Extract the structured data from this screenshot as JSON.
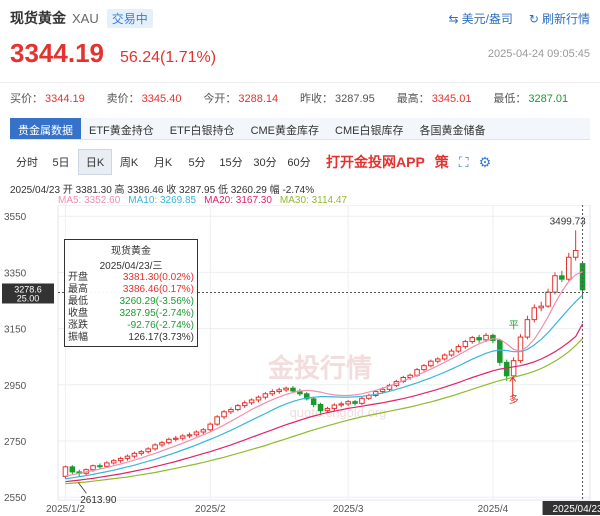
{
  "header": {
    "name": "现货黄金",
    "code": "XAU",
    "status": "交易中",
    "unit_link": "美元/盎司",
    "refresh": "刷新行情"
  },
  "quote": {
    "price": "3344.19",
    "change": "56.24(1.71%)",
    "datetime": "2025-04-24 09:05:45"
  },
  "stats": [
    {
      "label": "买价：",
      "value": "3344.19",
      "cls": "up"
    },
    {
      "label": "卖价：",
      "value": "3345.40",
      "cls": "up"
    },
    {
      "label": "今开：",
      "value": "3288.14",
      "cls": "up"
    },
    {
      "label": "昨收：",
      "value": "3287.95",
      "cls": ""
    },
    {
      "label": "最高：",
      "value": "3345.01",
      "cls": "up"
    },
    {
      "label": "最低：",
      "value": "3287.01",
      "cls": "dn"
    }
  ],
  "data_tabs": [
    "贵金属数据",
    "ETF黄金持仓",
    "ETF白银持仓",
    "CME黄金库存",
    "CME白银库存",
    "各国黄金储备"
  ],
  "period_tabs": [
    "分时",
    "5日",
    "日K",
    "周K",
    "月K",
    "5分",
    "15分",
    "30分",
    "60分"
  ],
  "app_promo": "打开金投网APP",
  "toolbar_icons": [
    "strategy-icon",
    "fullscreen-icon",
    "settings-icon"
  ],
  "toolbar_glyphs": [
    "策",
    "⛶",
    "⚙"
  ],
  "ohlc_line": "2025/04/23  开 3381.30  高 3386.46  收 3287.95  低 3260.29  幅 -2.74%",
  "ma_legend": [
    {
      "label": "MA5: 3352.60",
      "color": "#f08fb0"
    },
    {
      "label": "MA10: 3269.85",
      "color": "#3ab6d9"
    },
    {
      "label": "MA20: 3167.30",
      "color": "#e0246b"
    },
    {
      "label": "MA30: 3114.47",
      "color": "#8fbb2e"
    }
  ],
  "tooltip": {
    "title": "现货黄金",
    "date": "2025/04/23/三",
    "rows": [
      {
        "label": "开盘",
        "value": "3381.30(0.02%)",
        "cls": "up"
      },
      {
        "label": "最高",
        "value": "3386.46(0.17%)",
        "cls": "up"
      },
      {
        "label": "最低",
        "value": "3260.29(-3.56%)",
        "cls": "dn"
      },
      {
        "label": "收盘",
        "value": "3287.95(-2.74%)",
        "cls": "dn"
      },
      {
        "label": "涨跌",
        "value": "-92.76(-2.74%)",
        "cls": "dn"
      },
      {
        "label": "振幅",
        "value": "126.17(3.73%)",
        "cls": ""
      }
    ]
  },
  "crosshair": {
    "price_label": "3278.6",
    "sub_label": "25.00",
    "date_label": "2025/04/23"
  },
  "annotations": {
    "max_label": "3499.73",
    "min_label": "2613.90",
    "ping_label": "平",
    "duo_label": "多"
  },
  "watermark": {
    "main": "金投行情",
    "sub": "quote.cngold.org"
  },
  "colors": {
    "up": "#e4322f",
    "down": "#1a9b2e",
    "accent": "#3672c9"
  },
  "chart_data": {
    "type": "candlestick",
    "y_ticks": [
      2550,
      2750,
      2950,
      3150,
      3350,
      3550
    ],
    "ylim": [
      2540,
      3590
    ],
    "x_ticks": [
      "2025/1/2",
      "2025/2",
      "2025/3",
      "2025/4"
    ],
    "x_tick_index": [
      0,
      21,
      41,
      62
    ],
    "candles": [
      [
        2624,
        2658,
        2616,
        2662
      ],
      [
        2658,
        2640,
        2632,
        2664
      ],
      [
        2640,
        2635,
        2622,
        2648
      ],
      [
        2635,
        2648,
        2628,
        2652
      ],
      [
        2648,
        2662,
        2640,
        2666
      ],
      [
        2662,
        2660,
        2652,
        2670
      ],
      [
        2660,
        2672,
        2654,
        2678
      ],
      [
        2672,
        2680,
        2666,
        2686
      ],
      [
        2680,
        2688,
        2672,
        2694
      ],
      [
        2688,
        2696,
        2680,
        2702
      ],
      [
        2696,
        2706,
        2688,
        2712
      ],
      [
        2706,
        2712,
        2698,
        2718
      ],
      [
        2712,
        2722,
        2706,
        2728
      ],
      [
        2722,
        2736,
        2716,
        2742
      ],
      [
        2736,
        2744,
        2728,
        2750
      ],
      [
        2744,
        2756,
        2738,
        2762
      ],
      [
        2756,
        2760,
        2748,
        2768
      ],
      [
        2760,
        2768,
        2752,
        2774
      ],
      [
        2768,
        2772,
        2760,
        2780
      ],
      [
        2772,
        2782,
        2766,
        2788
      ],
      [
        2782,
        2790,
        2774,
        2796
      ],
      [
        2790,
        2810,
        2784,
        2816
      ],
      [
        2810,
        2836,
        2804,
        2842
      ],
      [
        2836,
        2854,
        2828,
        2860
      ],
      [
        2854,
        2862,
        2846,
        2870
      ],
      [
        2862,
        2876,
        2856,
        2882
      ],
      [
        2876,
        2886,
        2868,
        2894
      ],
      [
        2886,
        2896,
        2878,
        2902
      ],
      [
        2896,
        2906,
        2888,
        2912
      ],
      [
        2906,
        2918,
        2898,
        2924
      ],
      [
        2918,
        2926,
        2910,
        2934
      ],
      [
        2926,
        2932,
        2918,
        2940
      ],
      [
        2932,
        2938,
        2924,
        2944
      ],
      [
        2938,
        2928,
        2920,
        2946
      ],
      [
        2928,
        2918,
        2910,
        2936
      ],
      [
        2918,
        2900,
        2894,
        2924
      ],
      [
        2900,
        2880,
        2870,
        2906
      ],
      [
        2880,
        2858,
        2848,
        2886
      ],
      [
        2858,
        2866,
        2850,
        2872
      ],
      [
        2866,
        2878,
        2858,
        2884
      ],
      [
        2878,
        2882,
        2870,
        2890
      ],
      [
        2882,
        2890,
        2874,
        2896
      ],
      [
        2890,
        2884,
        2876,
        2896
      ],
      [
        2884,
        2902,
        2878,
        2908
      ],
      [
        2902,
        2912,
        2896,
        2918
      ],
      [
        2912,
        2926,
        2906,
        2932
      ],
      [
        2926,
        2934,
        2918,
        2942
      ],
      [
        2934,
        2948,
        2928,
        2954
      ],
      [
        2948,
        2962,
        2942,
        2968
      ],
      [
        2962,
        2976,
        2956,
        2982
      ],
      [
        2976,
        2984,
        2968,
        2990
      ],
      [
        2984,
        3004,
        2978,
        3010
      ],
      [
        3004,
        3018,
        2998,
        3024
      ],
      [
        3018,
        3034,
        3012,
        3040
      ],
      [
        3034,
        3042,
        3026,
        3048
      ],
      [
        3042,
        3056,
        3036,
        3062
      ],
      [
        3056,
        3070,
        3050,
        3078
      ],
      [
        3070,
        3086,
        3064,
        3094
      ],
      [
        3086,
        3104,
        3078,
        3110
      ],
      [
        3104,
        3118,
        3096,
        3124
      ],
      [
        3118,
        3110,
        3100,
        3128
      ],
      [
        3110,
        3126,
        3102,
        3134
      ],
      [
        3126,
        3108,
        3098,
        3132
      ],
      [
        3108,
        3030,
        3018,
        3114
      ],
      [
        3030,
        2982,
        2964,
        3040
      ],
      [
        2982,
        3036,
        2970,
        3048
      ],
      [
        3036,
        3120,
        3028,
        3130
      ],
      [
        3120,
        3182,
        3112,
        3196
      ],
      [
        3182,
        3224,
        3172,
        3236
      ],
      [
        3224,
        3230,
        3212,
        3246
      ],
      [
        3230,
        3280,
        3224,
        3292
      ],
      [
        3280,
        3338,
        3272,
        3350
      ],
      [
        3338,
        3326,
        3316,
        3356
      ],
      [
        3326,
        3404,
        3318,
        3420
      ],
      [
        3404,
        3428,
        3392,
        3499.73
      ],
      [
        3381.3,
        3287.95,
        3260.29,
        3386.46
      ]
    ],
    "ma5": [
      2625,
      2630,
      2635,
      2640,
      2645,
      2650,
      2656,
      2662,
      2668,
      2675,
      2682,
      2690,
      2698,
      2706,
      2715,
      2724,
      2733,
      2742,
      2752,
      2762,
      2772,
      2782,
      2794,
      2807,
      2820,
      2834,
      2848,
      2862,
      2874,
      2886,
      2897,
      2907,
      2916,
      2923,
      2928,
      2930,
      2928,
      2924,
      2918,
      2914,
      2912,
      2912,
      2914,
      2918,
      2924,
      2930,
      2938,
      2946,
      2955,
      2964,
      2974,
      2984,
      2995,
      3006,
      3018,
      3030,
      3043,
      3056,
      3070,
      3084,
      3096,
      3106,
      3114,
      3112,
      3096,
      3076,
      3070,
      3086,
      3112,
      3150,
      3192,
      3240,
      3282,
      3318,
      3342,
      3352.6
    ],
    "ma10": [
      2615,
      2619,
      2623,
      2627,
      2631,
      2636,
      2641,
      2646,
      2652,
      2658,
      2664,
      2671,
      2678,
      2685,
      2693,
      2701,
      2709,
      2718,
      2727,
      2736,
      2746,
      2756,
      2766,
      2777,
      2788,
      2800,
      2812,
      2824,
      2836,
      2848,
      2860,
      2872,
      2882,
      2891,
      2898,
      2903,
      2906,
      2908,
      2908,
      2907,
      2906,
      2906,
      2907,
      2909,
      2912,
      2916,
      2921,
      2927,
      2934,
      2941,
      2949,
      2957,
      2966,
      2975,
      2985,
      2995,
      3006,
      3017,
      3029,
      3041,
      3052,
      3062,
      3070,
      3074,
      3072,
      3068,
      3068,
      3076,
      3092,
      3112,
      3136,
      3164,
      3192,
      3220,
      3246,
      3269.85
    ],
    "ma20": [
      2605,
      2608,
      2611,
      2614,
      2617,
      2621,
      2625,
      2629,
      2633,
      2638,
      2643,
      2648,
      2653,
      2659,
      2665,
      2671,
      2677,
      2684,
      2691,
      2698,
      2705,
      2712,
      2720,
      2728,
      2736,
      2745,
      2754,
      2763,
      2772,
      2781,
      2790,
      2799,
      2808,
      2816,
      2824,
      2832,
      2839,
      2845,
      2851,
      2856,
      2861,
      2866,
      2870,
      2874,
      2878,
      2882,
      2886,
      2891,
      2896,
      2901,
      2907,
      2913,
      2920,
      2927,
      2934,
      2942,
      2950,
      2958,
      2967,
      2976,
      2984,
      2992,
      3000,
      3006,
      3010,
      3014,
      3018,
      3024,
      3032,
      3042,
      3054,
      3068,
      3084,
      3102,
      3122,
      3167.3
    ],
    "ma30": [
      2598,
      2600,
      2602,
      2604,
      2607,
      2610,
      2613,
      2616,
      2619,
      2622,
      2626,
      2630,
      2634,
      2638,
      2643,
      2648,
      2653,
      2658,
      2663,
      2668,
      2674,
      2680,
      2686,
      2692,
      2699,
      2706,
      2713,
      2720,
      2727,
      2734,
      2742,
      2750,
      2758,
      2766,
      2774,
      2782,
      2790,
      2797,
      2804,
      2811,
      2818,
      2824,
      2830,
      2836,
      2841,
      2846,
      2851,
      2856,
      2861,
      2866,
      2871,
      2877,
      2883,
      2889,
      2896,
      2903,
      2910,
      2918,
      2926,
      2934,
      2942,
      2950,
      2958,
      2965,
      2971,
      2977,
      2983,
      2990,
      2998,
      3008,
      3020,
      3034,
      3050,
      3068,
      3090,
      3114.47
    ]
  }
}
